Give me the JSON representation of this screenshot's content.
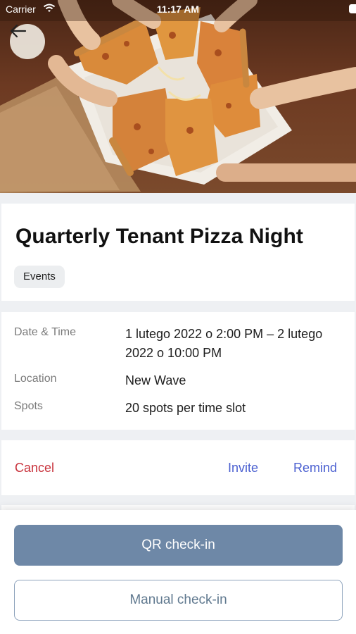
{
  "status_bar": {
    "carrier": "Carrier",
    "time": "11:17 AM"
  },
  "hero": {
    "image_subject": "pizza-photo",
    "back_icon": "arrow-left-icon"
  },
  "event": {
    "title": "Quarterly Tenant Pizza Night",
    "category": "Events"
  },
  "details": {
    "date_time_label": "Date & Time",
    "date_time_value": "1 lutego 2022 o 2:00 PM – 2 lutego 2022 o 10:00 PM",
    "location_label": "Location",
    "location_value": "New Wave",
    "spots_label": "Spots",
    "spots_value": "20 spots per time slot"
  },
  "actions": {
    "cancel": "Cancel",
    "invite": "Invite",
    "remind": "Remind"
  },
  "bottom": {
    "qr_checkin": "QR check-in",
    "manual_checkin": "Manual check-in"
  },
  "colors": {
    "primary_button": "#6e88a7",
    "link_blue": "#4a5fd0",
    "danger_red": "#c8323c",
    "background": "#eef0f3"
  }
}
